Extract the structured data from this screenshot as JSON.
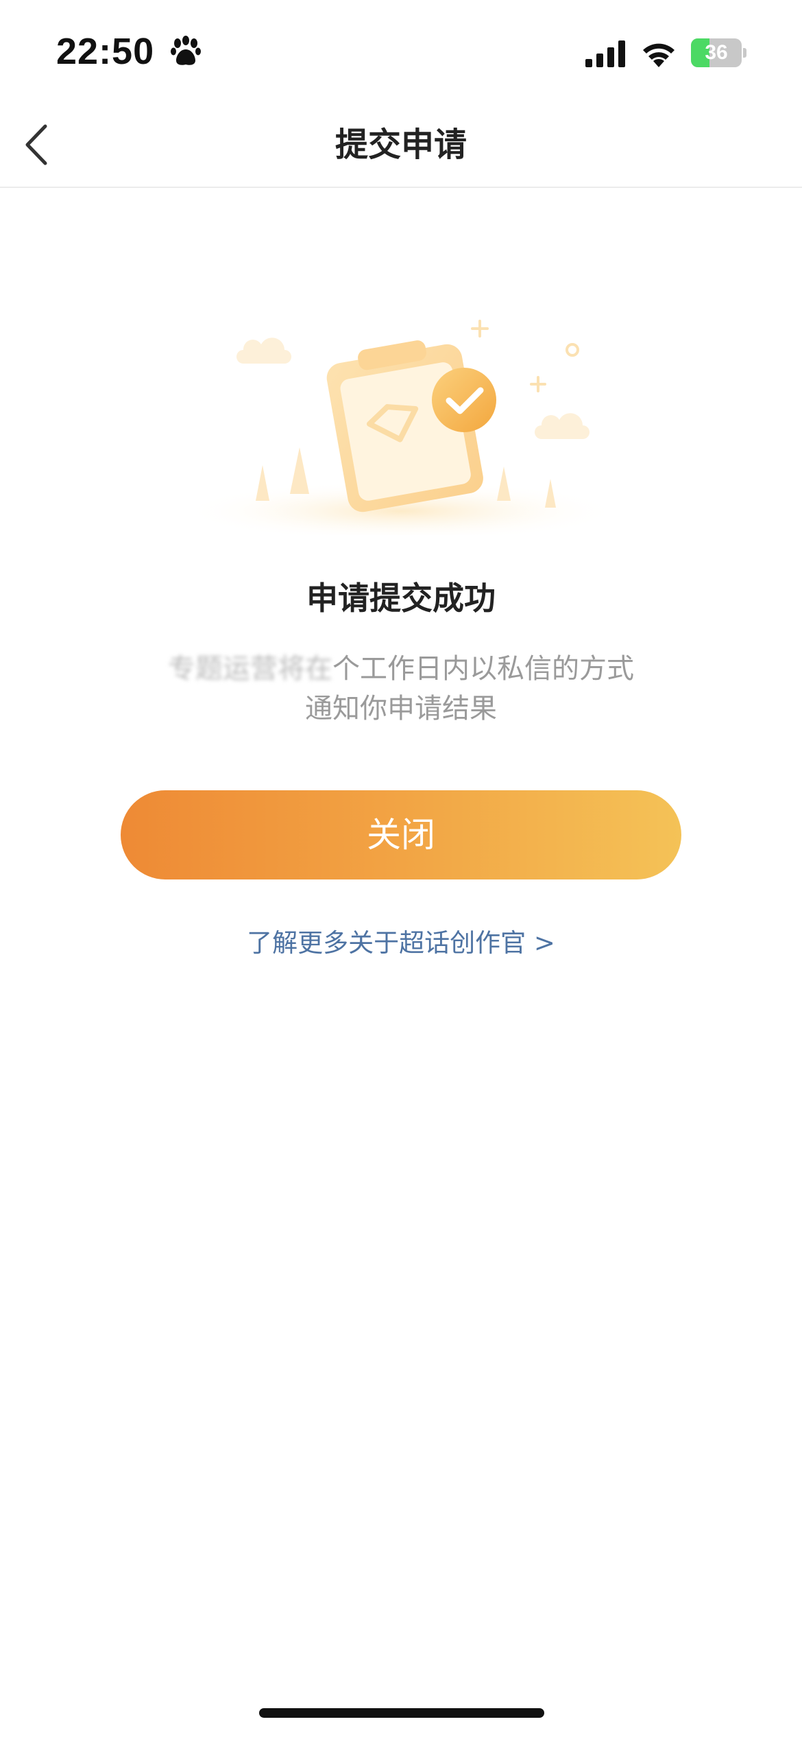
{
  "status_bar": {
    "time": "22:50",
    "battery_level": "36",
    "battery_fraction": 0.36
  },
  "nav": {
    "title": "提交申请",
    "back_icon": "chevron-left-icon"
  },
  "result": {
    "title": "申请提交成功",
    "desc_blurred": "专题运营将在",
    "desc_visible": "个工作日内以私信的方式通知你申请结果"
  },
  "actions": {
    "close_label": "关闭",
    "learn_more_label": "了解更多关于超话创作官 >"
  },
  "colors": {
    "accent_start": "#ee8a35",
    "accent_end": "#f4c257",
    "link": "#4e73a3"
  }
}
